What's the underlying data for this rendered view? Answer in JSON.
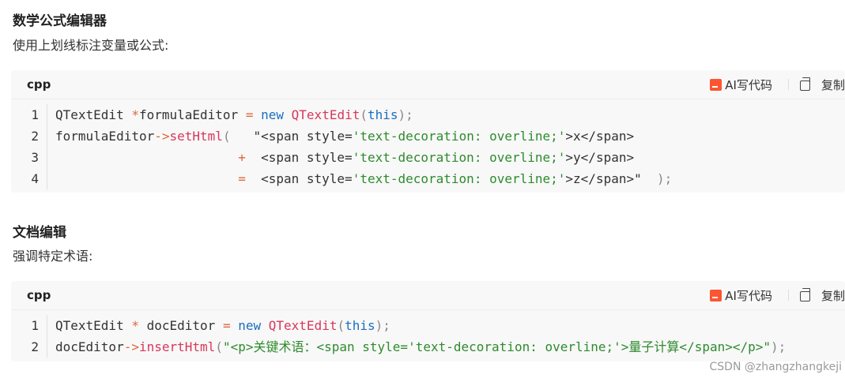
{
  "section1": {
    "title": "数学公式编辑器",
    "desc": "使用上划线标注变量或公式:"
  },
  "section2": {
    "title": "文档编辑",
    "desc": "强调特定术语:"
  },
  "code_toolbar": {
    "lang": "cpp",
    "ai_label": "AI写代码",
    "copy_label": "复制"
  },
  "code1": {
    "lines": [
      {
        "num": "1",
        "tokens": [
          {
            "t": "QTextEdit ",
            "c": "plain"
          },
          {
            "t": "*",
            "c": "op"
          },
          {
            "t": "formulaEditor ",
            "c": "plain"
          },
          {
            "t": "=",
            "c": "op"
          },
          {
            "t": " ",
            "c": "plain"
          },
          {
            "t": "new",
            "c": "kw"
          },
          {
            "t": " ",
            "c": "plain"
          },
          {
            "t": "QTextEdit",
            "c": "fn"
          },
          {
            "t": "(",
            "c": "punc"
          },
          {
            "t": "this",
            "c": "kw"
          },
          {
            "t": ");",
            "c": "punc"
          }
        ]
      },
      {
        "num": "2",
        "tokens": [
          {
            "t": "formulaEditor",
            "c": "plain"
          },
          {
            "t": "->",
            "c": "op"
          },
          {
            "t": "setHtml",
            "c": "fn"
          },
          {
            "t": "(",
            "c": "punc"
          },
          {
            "t": "   \"<span style=",
            "c": "plain"
          },
          {
            "t": "'text-decoration: overline;'",
            "c": "str"
          },
          {
            "t": ">x</span>",
            "c": "plain"
          }
        ]
      },
      {
        "num": "3",
        "tokens": [
          {
            "t": "                        ",
            "c": "plain"
          },
          {
            "t": "+",
            "c": "op"
          },
          {
            "t": "  <span style=",
            "c": "plain"
          },
          {
            "t": "'text-decoration: overline;'",
            "c": "str"
          },
          {
            "t": ">y</span>",
            "c": "plain"
          }
        ]
      },
      {
        "num": "4",
        "tokens": [
          {
            "t": "                        ",
            "c": "plain"
          },
          {
            "t": "=",
            "c": "op"
          },
          {
            "t": "  <span style=",
            "c": "plain"
          },
          {
            "t": "'text-decoration: overline;'",
            "c": "str"
          },
          {
            "t": ">z</span>\"  ",
            "c": "plain"
          },
          {
            "t": ");",
            "c": "punc"
          }
        ]
      }
    ]
  },
  "code2": {
    "lines": [
      {
        "num": "1",
        "tokens": [
          {
            "t": "QTextEdit ",
            "c": "plain"
          },
          {
            "t": "*",
            "c": "op"
          },
          {
            "t": " docEditor ",
            "c": "plain"
          },
          {
            "t": "=",
            "c": "op"
          },
          {
            "t": " ",
            "c": "plain"
          },
          {
            "t": "new",
            "c": "kw"
          },
          {
            "t": " ",
            "c": "plain"
          },
          {
            "t": "QTextEdit",
            "c": "fn"
          },
          {
            "t": "(",
            "c": "punc"
          },
          {
            "t": "this",
            "c": "kw"
          },
          {
            "t": ");",
            "c": "punc"
          }
        ]
      },
      {
        "num": "2",
        "tokens": [
          {
            "t": "docEditor",
            "c": "plain"
          },
          {
            "t": "->",
            "c": "op"
          },
          {
            "t": "insertHtml",
            "c": "fn"
          },
          {
            "t": "(",
            "c": "punc"
          },
          {
            "t": "\"<p>关键术语：<span style=",
            "c": "str"
          },
          {
            "t": "'text-decoration: overline;'",
            "c": "str"
          },
          {
            "t": ">量子计算</span></p>\"",
            "c": "str"
          },
          {
            "t": ");",
            "c": "punc"
          }
        ]
      }
    ]
  },
  "watermark": "CSDN @zhangzhangkeji"
}
